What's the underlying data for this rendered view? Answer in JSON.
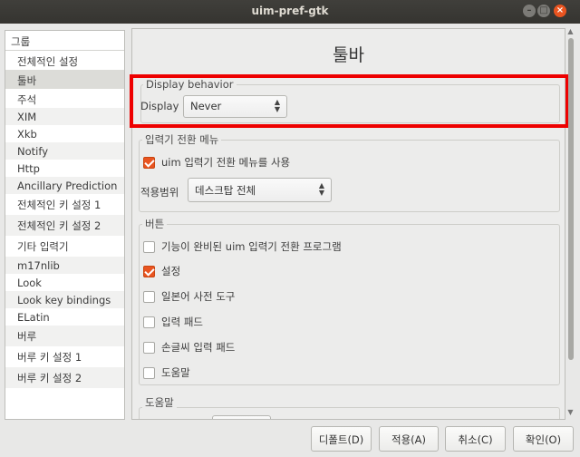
{
  "window": {
    "title": "uim-pref-gtk"
  },
  "sidebar": {
    "header": "그룹",
    "items": [
      {
        "label": "전체적인 설정"
      },
      {
        "label": "툴바"
      },
      {
        "label": "주석"
      },
      {
        "label": "XIM"
      },
      {
        "label": "Xkb"
      },
      {
        "label": "Notify"
      },
      {
        "label": "Http"
      },
      {
        "label": "Ancillary Prediction"
      },
      {
        "label": "전체적인 키 설정 1"
      },
      {
        "label": "전체적인 키 설정 2"
      },
      {
        "label": "기타 입력기"
      },
      {
        "label": "m17nlib"
      },
      {
        "label": "Look"
      },
      {
        "label": "Look key bindings"
      },
      {
        "label": "ELatin"
      },
      {
        "label": "버루"
      },
      {
        "label": "버루 키 설정 1"
      },
      {
        "label": "버루 키 설정 2"
      }
    ],
    "selected": "툴바"
  },
  "main": {
    "title": "툴바",
    "display_behavior": {
      "group_label": "Display behavior",
      "display_label": "Display",
      "display_value": "Never"
    },
    "im_switch_menu": {
      "group_label": "입력기 전환 메뉴",
      "use_label": "uim 입력기 전환 메뉴를 사용",
      "use_checked": true,
      "scope_label": "적용범위",
      "scope_value": "데스크탑 전체"
    },
    "buttons": {
      "group_label": "버튼",
      "items": [
        {
          "label": "기능이 완비된 uim 입력기 전환 프로그램",
          "checked": false
        },
        {
          "label": "설정",
          "checked": true
        },
        {
          "label": "일본어 사전 도구",
          "checked": false
        },
        {
          "label": "입력 패드",
          "checked": false
        },
        {
          "label": "손글씨 입력 패드",
          "checked": false
        },
        {
          "label": "도움말",
          "checked": false
        }
      ]
    },
    "help": {
      "group_label": "도움말"
    }
  },
  "footer": {
    "default_label": "디폴트(D)",
    "apply_label": "적용(A)",
    "cancel_label": "취소(C)",
    "ok_label": "확인(O)"
  },
  "colors": {
    "accent": "#e95420",
    "highlight": "#ee0000",
    "titlebar": "#3c3b37"
  }
}
